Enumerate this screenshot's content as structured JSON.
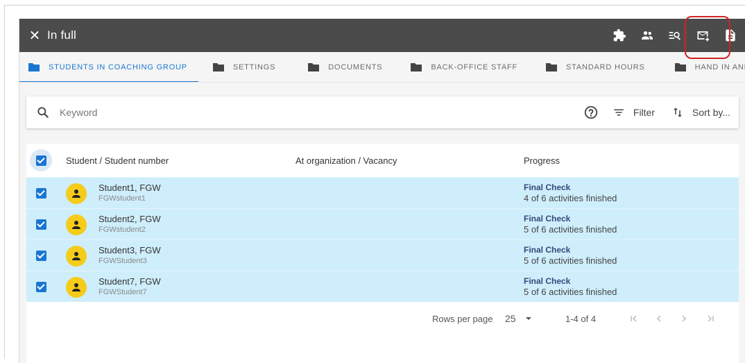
{
  "header": {
    "title": "In full",
    "actions": [
      {
        "icon": "puzzle-icon"
      },
      {
        "icon": "group-icon"
      },
      {
        "icon": "search-list-icon"
      },
      {
        "icon": "mail-icon"
      },
      {
        "icon": "document-icon"
      }
    ]
  },
  "tabs": [
    {
      "label": "STUDENTS IN COACHING GROUP",
      "active": true
    },
    {
      "label": "SETTINGS"
    },
    {
      "label": "DOCUMENTS"
    },
    {
      "label": "BACK-OFFICE STAFF"
    },
    {
      "label": "STANDARD HOURS"
    },
    {
      "label": "HAND IN AND ASSESS"
    }
  ],
  "search": {
    "placeholder": "Keyword",
    "filter_label": "Filter",
    "sort_label": "Sort by..."
  },
  "table": {
    "columns": {
      "student": "Student / Student number",
      "org": "At organization / Vacancy",
      "progress": "Progress"
    },
    "rows": [
      {
        "name": "Student1, FGW",
        "number": "FGWstudent1",
        "phase": "Final Check",
        "detail": "4 of 6 activities finished"
      },
      {
        "name": "Student2, FGW",
        "number": "FGWstudent2",
        "phase": "Final Check",
        "detail": "5 of 6 activities finished"
      },
      {
        "name": "Student3, FGW",
        "number": "FGWStudent3",
        "phase": "Final Check",
        "detail": "5 of 6 activities finished"
      },
      {
        "name": "Student7, FGW",
        "number": "FGWStudent7",
        "phase": "Final Check",
        "detail": "5 of 6 activities finished"
      }
    ]
  },
  "pagination": {
    "rows_per_page_label": "Rows per page",
    "rows_per_page": "25",
    "range": "1-4 of 4"
  },
  "colors": {
    "topbar": "#4b4b4b",
    "accent": "#1976d2",
    "row_selected": "#cfeefc",
    "avatar": "#f5cc1a",
    "highlight": "#d32222"
  }
}
